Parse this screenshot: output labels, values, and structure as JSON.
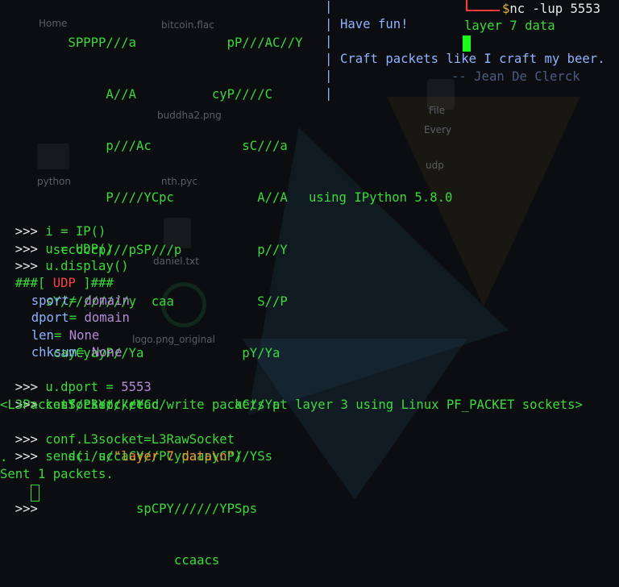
{
  "desktop": {
    "icons": [
      "Home",
      "bitcoin.flac",
      "buddha2.png",
      "python",
      "nth.pyc",
      "daniel.txt",
      "logo.png_original",
      "File",
      "Every",
      "udp"
    ]
  },
  "banner": {
    "art_lines": [
      "         SPPPP///a            pP///AC//Y",
      "              A//A          cyP////C",
      "              p///Ac            sC///a",
      "              P////YCpc           A//A",
      "       scccccp///pSP///p          p//Y",
      "      sY/////////y  caa           S//P",
      "       cayCyayP//Ya             pY/Ya",
      "        sY/PsY////YCc          aC//Yp",
      "         sc  sccaCY//PCypaapyCP//YSs",
      "                  spCPY//////YPSps",
      "                       ccaacs"
    ],
    "separators": [
      "|",
      "|",
      "|",
      "|",
      "|",
      "|"
    ],
    "fun": "Have fun!",
    "quote": "Craft packets like I craft my beer.",
    "quote_author": "-- Jean De Clerck",
    "version": "using IPython 5.8.0"
  },
  "nc_window": {
    "prompt_char": "$",
    "command": "nc -lup 5553",
    "received": "layer 7 data"
  },
  "session": {
    "prompt": ">>>",
    "cmd1": "i = IP()",
    "cmd2": "u = UDP()",
    "cmd3": "u.display()",
    "udp_header_left": "###[",
    "udp_header_name": "UDP",
    "udp_header_right": "]###",
    "fields": [
      {
        "name": "sport",
        "eq": "=",
        "value": "domain"
      },
      {
        "name": "dport",
        "eq": "=",
        "value": "domain"
      },
      {
        "name": "len",
        "eq": "=",
        "value": "None"
      },
      {
        "name": "chksum",
        "eq": "=",
        "value": "None"
      }
    ],
    "cmd4_prefix": "u.dport =",
    "cmd4_value": "5553",
    "cmd5": "conf.L3socket",
    "out5": "<L3PacketSocket: read/write packets at layer 3 using Linux PF_PACKET sockets>",
    "cmd6": "conf.L3socket=L3RawSocket",
    "cmd7_prefix": "send(i/u/",
    "cmd7_string": "\"layer 7 data\\n\"",
    "cmd7_suffix": ")",
    "dot": ".",
    "sent": "Sent 1 packets."
  }
}
